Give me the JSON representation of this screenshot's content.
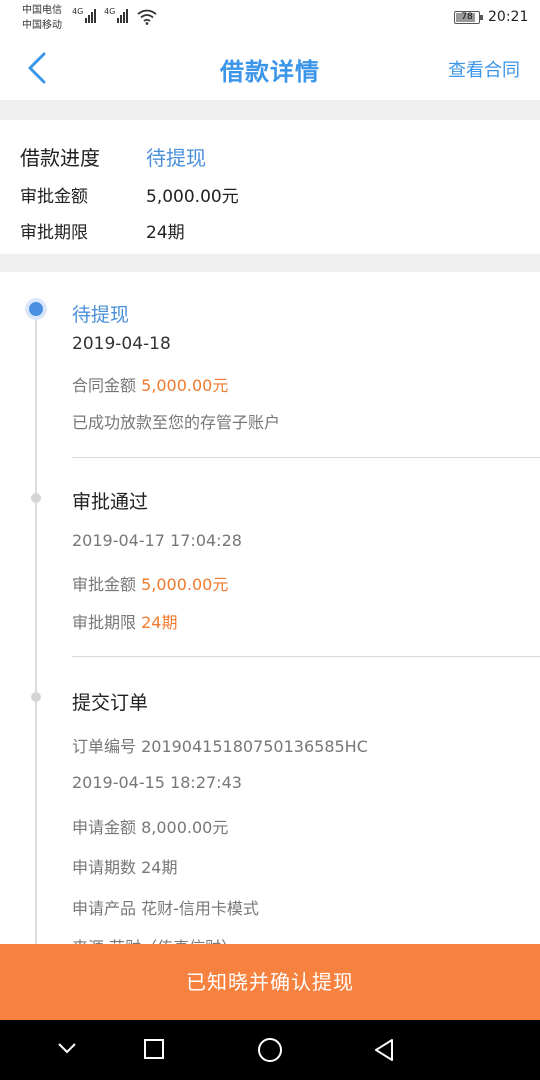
{
  "status": {
    "carrier1": "中国电信",
    "carrier2": "中国移动",
    "net1": "4G",
    "net2": "4G",
    "battery": "78",
    "time": "20:21"
  },
  "header": {
    "title": "借款详情",
    "view_contract": "查看合同"
  },
  "summary": {
    "progress_label": "借款进度",
    "progress_value": "待提现",
    "amount_label": "审批金额",
    "amount_value": "5,000.00元",
    "term_label": "审批期限",
    "term_value": "24期"
  },
  "timeline": {
    "step1": {
      "title": "待提现",
      "date": "2019-04-18",
      "contract_label": "合同金额",
      "contract_value": "5,000.00元",
      "note": "已成功放款至您的存管子账户"
    },
    "step2": {
      "title": "审批通过",
      "datetime": "2019-04-17 17:04:28",
      "amount_label": "审批金额",
      "amount_value": "5,000.00元",
      "term_label": "审批期限",
      "term_value": "24期"
    },
    "step3": {
      "title": "提交订单",
      "order_line": "订单编号 20190415180750136585HC",
      "datetime": "2019-04-15 18:27:43",
      "apply_amount": "申请金额 8,000.00元",
      "apply_term": "申请期数 24期",
      "apply_product": "申请产品 花财-信用卡模式",
      "source": "来源 花财（传真信财）"
    }
  },
  "confirm_button": "已知晓并确认提现",
  "colors": {
    "accent_blue": "#3b95e8",
    "orange": "#f07a2e",
    "button_orange": "#f7813f"
  }
}
